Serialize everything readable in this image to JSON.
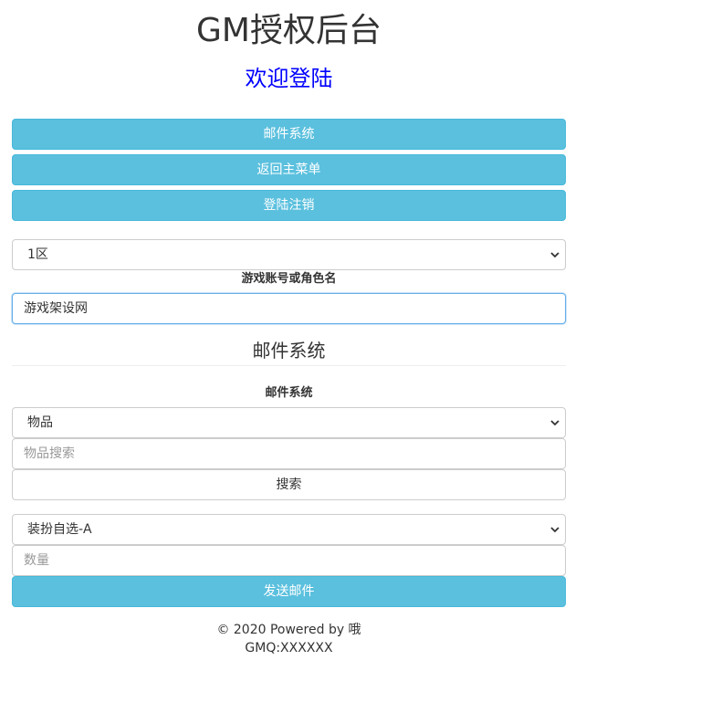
{
  "header": {
    "title": "GM授权后台",
    "subtitle": "欢迎登陆"
  },
  "nav": {
    "mail_system": "邮件系统",
    "back_main_menu": "返回主菜单",
    "logout": "登陆注销"
  },
  "account": {
    "server_selected": "1区",
    "label": "游戏账号或角色名",
    "value": "游戏架设网"
  },
  "mail": {
    "section_title": "邮件系统",
    "label": "邮件系统",
    "category_selected": "物品",
    "search_placeholder": "物品搜索",
    "search_button": "搜索",
    "item_selected": "装扮自选-A",
    "quantity_placeholder": "数量",
    "send_button": "发送邮件"
  },
  "footer": {
    "copyright": "© 2020 Powered by 哦",
    "contact": "GMQ:XXXXXX"
  },
  "colors": {
    "accent": "#5bc0de",
    "subtitle": "#0000ff",
    "focus": "#66afe9"
  },
  "icons": {
    "dropdown": "chevron-down-icon"
  }
}
